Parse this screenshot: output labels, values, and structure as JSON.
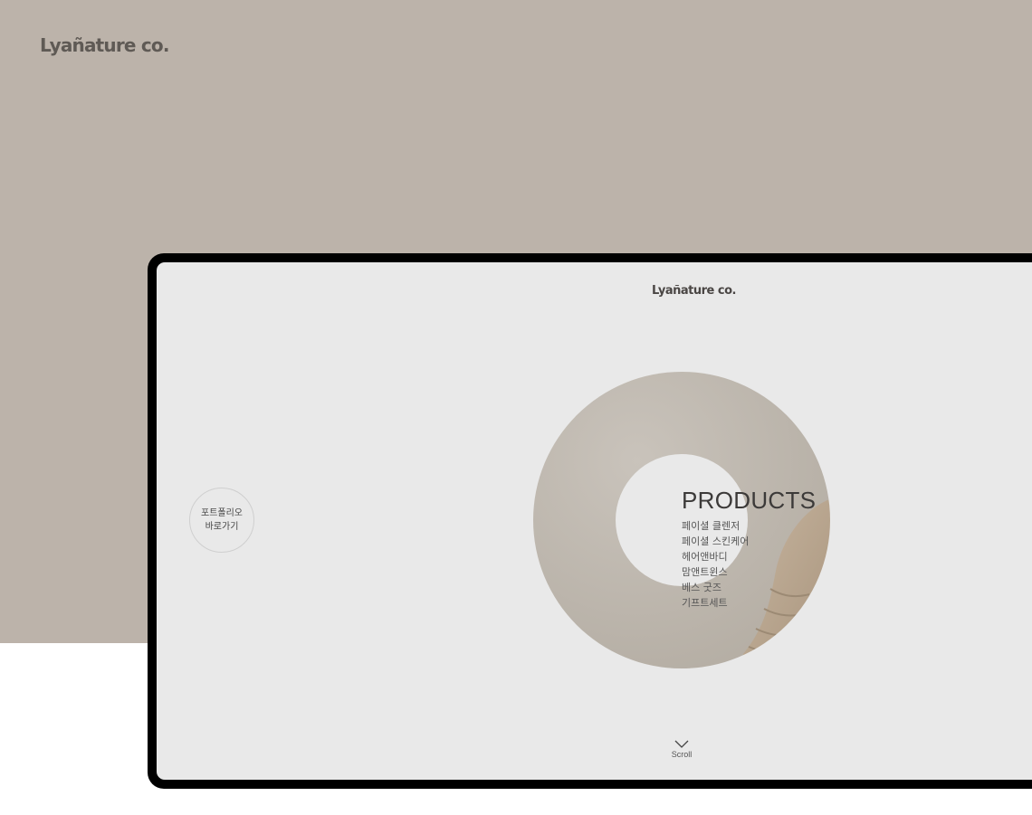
{
  "brand": {
    "logo_text": "Lyañature co."
  },
  "screen": {
    "logo_text": "Lyañature co.",
    "portfolio_button": {
      "line1": "포트폴리오",
      "line2": "바로가기"
    },
    "products": {
      "title": "PRODUCTS",
      "items": [
        "페이셜 클렌저",
        "페이셜 스킨케어",
        "헤어앤바디",
        "맘앤트윈스",
        "베스 굿즈",
        "기프트세트"
      ]
    },
    "scroll": {
      "label": "Scroll",
      "icon": "chevron-down-icon"
    }
  },
  "colors": {
    "backdrop": "#bcb3aa",
    "device_frame": "#000000",
    "screen_bg": "#e9e9e9",
    "ring": "#bfb8ae",
    "accent_fabric": "#b7a48e"
  }
}
